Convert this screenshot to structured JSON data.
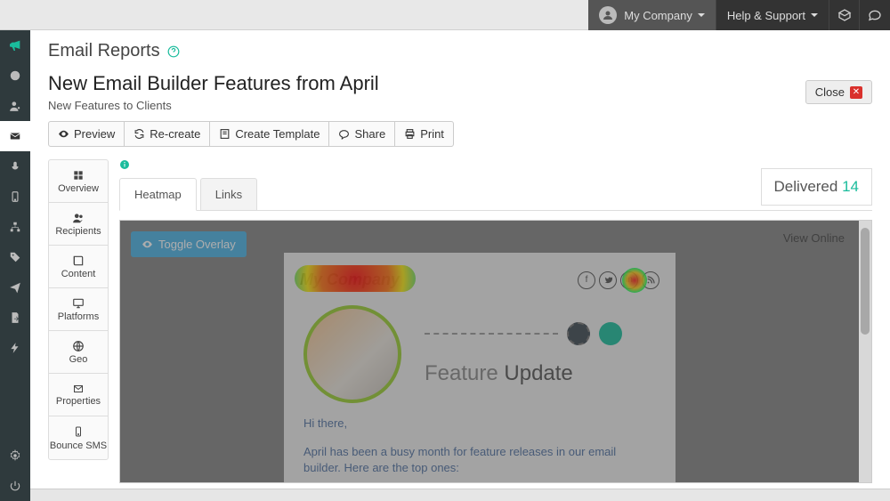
{
  "topbar": {
    "company_label": "My Company",
    "help_label": "Help & Support"
  },
  "page": {
    "title": "Email Reports",
    "campaign_title": "New Email Builder Features from April",
    "campaign_subtitle": "New Features to Clients",
    "close_label": "Close"
  },
  "toolbar": {
    "preview": "Preview",
    "recreate": "Re-create",
    "create_template": "Create Template",
    "share": "Share",
    "print": "Print"
  },
  "report_side": [
    {
      "label": "Overview"
    },
    {
      "label": "Recipients"
    },
    {
      "label": "Content"
    },
    {
      "label": "Platforms"
    },
    {
      "label": "Geo"
    },
    {
      "label": "Properties"
    },
    {
      "label": "Bounce SMS"
    }
  ],
  "tabs": {
    "heatmap": "Heatmap",
    "links": "Links"
  },
  "delivered": {
    "label": "Delivered",
    "value": "14"
  },
  "heatmap": {
    "toggle_label": "Toggle Overlay",
    "view_online": "View Online"
  },
  "email_preview": {
    "logo_text": "My Company",
    "feature_word1": "Feature",
    "feature_word2": "Update",
    "greeting": "Hi there,",
    "body": "April has been a busy month for feature releases in our email builder. Here are the top ones:"
  }
}
